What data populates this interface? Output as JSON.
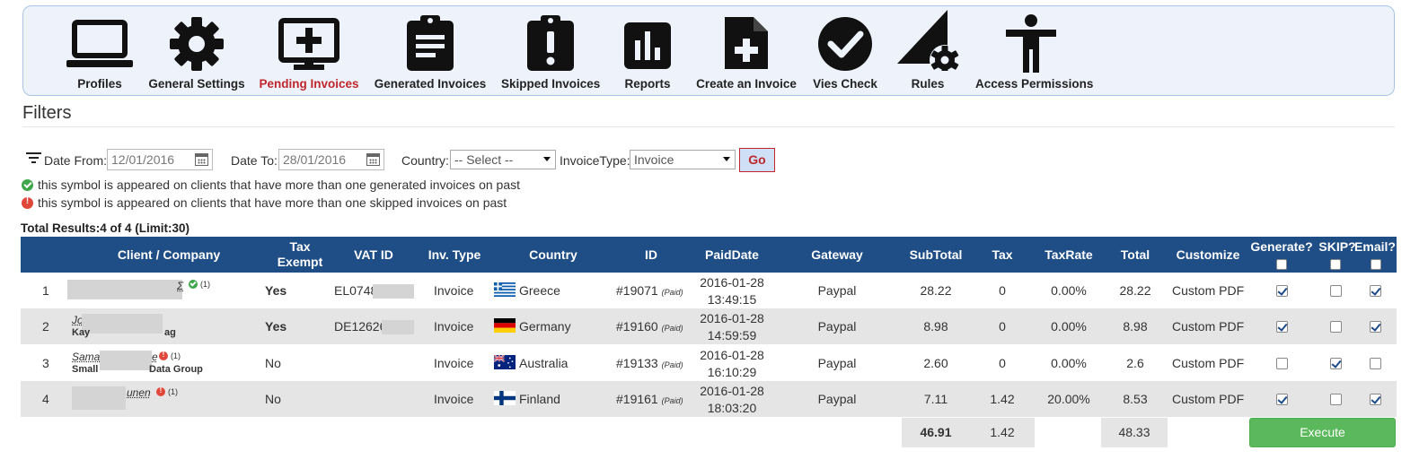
{
  "nav": {
    "items": [
      {
        "label": "Profiles",
        "icon": "laptop-icon"
      },
      {
        "label": "General Settings",
        "icon": "gear-icon"
      },
      {
        "label": "Pending Invoices",
        "icon": "monitor-plus-icon",
        "active": true
      },
      {
        "label": "Generated Invoices",
        "icon": "clipboard-list-icon"
      },
      {
        "label": "Skipped Invoices",
        "icon": "clipboard-alert-icon"
      },
      {
        "label": "Reports",
        "icon": "bar-chart-icon"
      },
      {
        "label": "Create an Invoice",
        "icon": "file-plus-icon"
      },
      {
        "label": "Vies Check",
        "icon": "check-circle-icon"
      },
      {
        "label": "Rules",
        "icon": "ruler-gear-icon"
      },
      {
        "label": "Access Permissions",
        "icon": "person-icon"
      }
    ]
  },
  "filters": {
    "title": "Filters",
    "date_from_label": "Date From:",
    "date_from_value": "12/01/2016",
    "date_to_label": "Date To:",
    "date_to_value": "28/01/2016",
    "country_label": "Country:",
    "country_value": "-- Select --",
    "invoice_type_label": "InvoiceType:",
    "invoice_type_value": "Invoice",
    "go_label": "Go"
  },
  "legend": {
    "generated": "this symbol is appeared on clients that have more than one generated invoices on past",
    "skipped": "this symbol is appeared on clients that have more than one skipped invoices on past"
  },
  "results": {
    "summary": "Total Results:4 of 4 (Limit:30)"
  },
  "table": {
    "headers": {
      "client": "Client / Company",
      "tax_exempt": "Tax Exempt",
      "vat_id": "VAT ID",
      "inv_type": "Inv. Type",
      "country": "Country",
      "id": "ID",
      "paid_date": "PaidDate",
      "gateway": "Gateway",
      "subtotal": "SubTotal",
      "tax": "Tax",
      "tax_rate": "TaxRate",
      "total": "Total",
      "customize": "Customize",
      "generate": "Generate?",
      "skip": "SKIP?",
      "email": "Email?"
    },
    "rows": [
      {
        "num": "1",
        "name_tail": "Σ",
        "count": "(1)",
        "company": "",
        "tax_exempt": "Yes",
        "tax_exempt_bold": true,
        "vat_id": "EL0748",
        "inv_type": "Invoice",
        "country": "Greece",
        "flag": "greece",
        "id": "#19071",
        "paid": "(Paid)",
        "date": "2016-01-28",
        "time": "13:49:15",
        "gateway": "Paypal",
        "subtotal": "28.22",
        "tax": "0",
        "tax_rate": "0.00%",
        "total": "28.22",
        "customize": "Custom PDF",
        "generate": true,
        "skip": false,
        "email": true,
        "badge": "green"
      },
      {
        "num": "2",
        "name_tail": "Jo",
        "count": "",
        "company": "Kay",
        "company_tail": "ag",
        "tax_exempt": "Yes",
        "tax_exempt_bold": true,
        "vat_id": "DE12626",
        "inv_type": "Invoice",
        "country": "Germany",
        "flag": "germany",
        "id": "#19160",
        "paid": "(Paid)",
        "date": "2016-01-28",
        "time": "14:59:59",
        "gateway": "Paypal",
        "subtotal": "8.98",
        "tax": "0",
        "tax_rate": "0.00%",
        "total": "8.98",
        "customize": "Custom PDF",
        "generate": true,
        "skip": false,
        "email": true,
        "badge": ""
      },
      {
        "num": "3",
        "name_tail": "Sama",
        "name_end": "e",
        "count": "(1)",
        "company": "Small",
        "company_tail": "Data Group",
        "tax_exempt": "No",
        "tax_exempt_bold": false,
        "vat_id": "",
        "inv_type": "Invoice",
        "country": "Australia",
        "flag": "australia",
        "id": "#19133",
        "paid": "(Paid)",
        "date": "2016-01-28",
        "time": "16:10:29",
        "gateway": "Paypal",
        "subtotal": "2.60",
        "tax": "0",
        "tax_rate": "0.00%",
        "total": "2.6",
        "customize": "Custom PDF",
        "generate": false,
        "skip": true,
        "email": false,
        "badge": "red"
      },
      {
        "num": "4",
        "name_tail": "",
        "name_end": "unen",
        "count": "(1)",
        "company": "",
        "tax_exempt": "No",
        "tax_exempt_bold": false,
        "vat_id": "",
        "inv_type": "Invoice",
        "country": "Finland",
        "flag": "finland",
        "id": "#19161",
        "paid": "(Paid)",
        "date": "2016-01-28",
        "time": "18:03:20",
        "gateway": "Paypal",
        "subtotal": "7.11",
        "tax": "1.42",
        "tax_rate": "20.00%",
        "total": "8.53",
        "customize": "Custom PDF",
        "generate": true,
        "skip": false,
        "email": true,
        "badge": "red"
      }
    ],
    "sums": {
      "subtotal": "46.91",
      "tax": "1.42",
      "total": "48.33"
    },
    "execute_label": "Execute"
  },
  "colors": {
    "header_bg": "#1f4e86",
    "active_nav": "#c0262c",
    "execute": "#5cb85c"
  }
}
